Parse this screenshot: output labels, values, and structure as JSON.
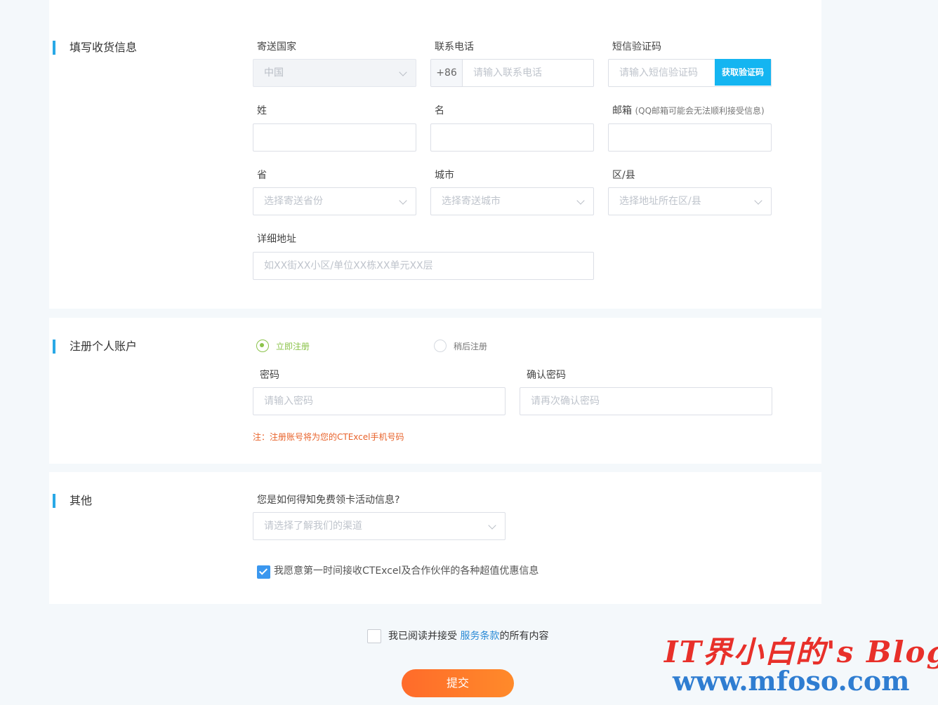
{
  "shipping": {
    "section_title": "填写收货信息",
    "country_label": "寄送国家",
    "country_value": "中国",
    "phone_label": "联系电话",
    "phone_prefix": "+86",
    "phone_placeholder": "请输入联系电话",
    "sms_label": "短信验证码",
    "sms_placeholder": "请输入短信验证码",
    "get_code_label": "获取验证码",
    "lastname_label": "姓",
    "firstname_label": "名",
    "email_label": "邮箱",
    "email_hint": "(QQ邮箱可能会无法顺利接受信息)",
    "province_label": "省",
    "province_placeholder": "选择寄送省份",
    "city_label": "城市",
    "city_placeholder": "选择寄送城市",
    "district_label": "区/县",
    "district_placeholder": "选择地址所在区/县",
    "address_label": "详细地址",
    "address_placeholder": "如XX街XX小区/单位XX栋XX单元XX层"
  },
  "register": {
    "section_title": "注册个人账户",
    "option_now": "立即注册",
    "option_later": "稍后注册",
    "password_label": "密码",
    "password_placeholder": "请输入密码",
    "confirm_label": "确认密码",
    "confirm_placeholder": "请再次确认密码",
    "note": "注：注册账号将为您的CTExcel手机号码"
  },
  "other": {
    "section_title": "其他",
    "channel_label": "您是如何得知免费领卡活动信息?",
    "channel_placeholder": "请选择了解我们的渠道",
    "promo_checkbox_text": "我愿意第一时间接收CTExcel及合作伙伴的各种超值优惠信息"
  },
  "agreement": {
    "prefix": "我已阅读并接受 ",
    "link": "服务条款",
    "suffix": "的所有内容"
  },
  "submit_label": "提交",
  "watermark": {
    "line1": "IT界小白的's Blog",
    "line2": "www.mfoso.com"
  },
  "colors": {
    "accent_blue": "#29a8e6",
    "get_code_bg": "#14b5f1",
    "radio_green": "#8bc34a",
    "note_orange": "#e8622a",
    "submit_gradient_start": "#ff6b2a",
    "submit_gradient_end": "#ff8a2a"
  }
}
